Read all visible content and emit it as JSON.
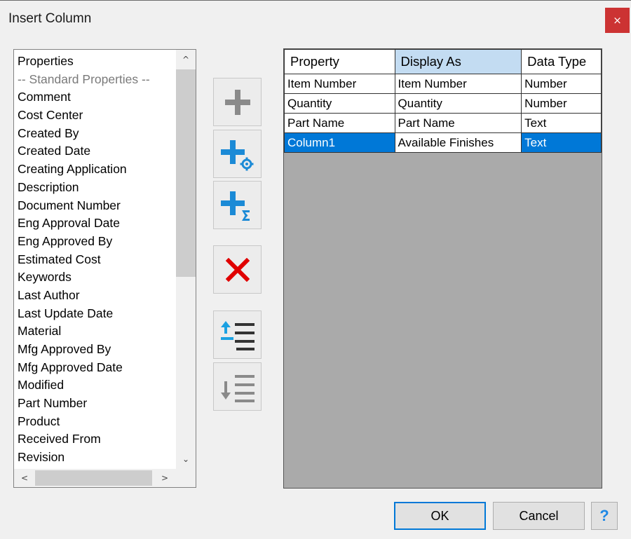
{
  "window": {
    "title": "Insert Column",
    "close_glyph": "×"
  },
  "property_list": {
    "header": "Properties",
    "group_label": "-- Standard Properties --",
    "items": [
      "Comment",
      "Cost Center",
      "Created By",
      "Created Date",
      "Creating Application",
      "Description",
      "Document Number",
      "Eng Approval Date",
      "Eng Approved By",
      "Estimated Cost",
      "Keywords",
      "Last Author",
      "Last Update Date",
      "Material",
      "Mfg Approved By",
      "Mfg Approved Date",
      "Modified",
      "Part Number",
      "Product",
      "Received From",
      "Revision"
    ],
    "scroll_up_glyph": "^",
    "scroll_down_glyph": "⌄",
    "scroll_left_glyph": "<",
    "scroll_right_glyph": ">"
  },
  "tools": {
    "icons": [
      "add-icon",
      "add-custom-property-icon",
      "add-formula-icon",
      "delete-icon",
      "move-up-icon",
      "move-down-icon"
    ],
    "accent_blue": "#1b8ad6",
    "delete_red": "#e00000",
    "disabled_gray": "#8a8a8a"
  },
  "grid": {
    "columns": [
      "Property",
      "Display As",
      "Data Type"
    ],
    "rows": [
      [
        "Item Number",
        "Item Number",
        "Number"
      ],
      [
        "Quantity",
        "Quantity",
        "Number"
      ],
      [
        "Part Name",
        "Part Name",
        "Text"
      ],
      [
        "Column1",
        "Available Finishes",
        "Text"
      ]
    ],
    "selected_row": 3,
    "selection_color": "#0078d7",
    "sorted_header_color": "#c3dcf2"
  },
  "buttons": {
    "ok": "OK",
    "cancel": "Cancel",
    "help": "?"
  }
}
